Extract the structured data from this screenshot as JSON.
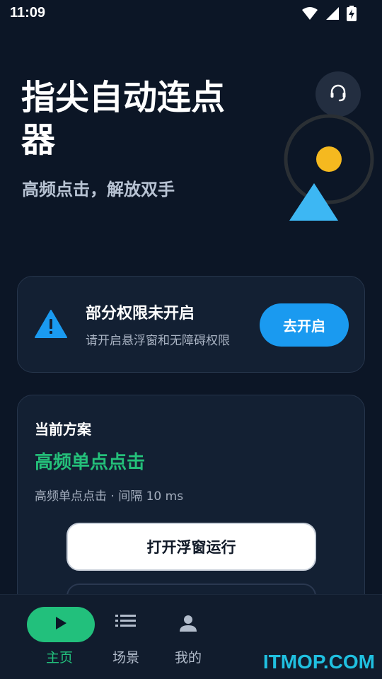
{
  "status_bar": {
    "time": "11:09",
    "icons": [
      "wifi-icon",
      "signal-icon",
      "battery-charging-icon"
    ]
  },
  "hero": {
    "title": "指尖自动连点器",
    "subtitle": "高频点击，解放双手",
    "support_icon": "headset-icon",
    "decor_colors": {
      "sun": "#f5b91f",
      "triangle": "#3db7f3",
      "ring": "#2a2f34"
    }
  },
  "permission_card": {
    "icon": "warning-icon",
    "title": "部分权限未开启",
    "description": "请开启悬浮窗和无障碍权限",
    "button_label": "去开启",
    "accent_color": "#1a9af0"
  },
  "plan_card": {
    "heading": "当前方案",
    "plan_name": "高频单点点击",
    "plan_detail": "高频单点点击 · 间隔 10 ms",
    "primary_button_label": "打开浮窗运行",
    "plan_name_color": "#24c07a"
  },
  "bottom_nav": {
    "items": [
      {
        "label": "主页",
        "icon": "play-icon",
        "active": true
      },
      {
        "label": "场景",
        "icon": "list-icon",
        "active": false
      },
      {
        "label": "我的",
        "icon": "person-icon",
        "active": false
      }
    ],
    "active_color": "#22c07c"
  },
  "watermark": "ITMOP.COM"
}
